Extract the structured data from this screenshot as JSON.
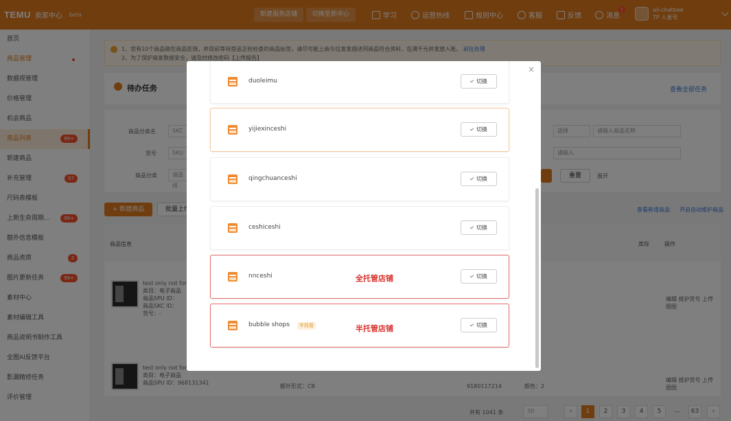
{
  "topbar": {
    "logo": "TEMU",
    "subtitle": "卖家中心",
    "beta": "beta",
    "buttons": [
      "新建服务店铺",
      "切换至新中心"
    ],
    "nav": [
      {
        "label": "学习",
        "icon": "book-icon"
      },
      {
        "label": "运营热线",
        "icon": "chat-icon"
      },
      {
        "label": "规则中心",
        "icon": "rules-icon"
      },
      {
        "label": "客服",
        "icon": "headset-icon"
      },
      {
        "label": "反馈",
        "icon": "feedback-icon"
      },
      {
        "label": "消息",
        "icon": "bell-icon"
      }
    ],
    "user_line1": "ali-chatbee",
    "user_line2": "TP 人发号"
  },
  "sidebar": {
    "items": [
      {
        "label": "首页"
      },
      {
        "label": "商品管理",
        "dot": true
      },
      {
        "label": "数据视管理"
      },
      {
        "label": "价格管理"
      },
      {
        "label": "机会商品"
      },
      {
        "label": "商品列表",
        "badge": "99+"
      },
      {
        "label": "新建商品"
      },
      {
        "label": "补充管理",
        "badge": "57"
      },
      {
        "label": "尺码表模板"
      },
      {
        "label": "上新生命周期...",
        "badge": "99+"
      },
      {
        "label": "额外信息模板"
      },
      {
        "label": "商品资质",
        "badge": "3"
      },
      {
        "label": "图片更新任务",
        "badge": "99+"
      },
      {
        "label": "素材中心"
      },
      {
        "label": "素材编辑工具"
      },
      {
        "label": "商品说明书制作工具"
      },
      {
        "label": "全图AI反馈平台"
      },
      {
        "label": "影漏精修任务"
      },
      {
        "label": "评价管理"
      }
    ]
  },
  "main": {
    "notice_line1": "1、您有10个商品做在商品反馈，并目前等待首运正检检查的商品标签，请尽可能上商与位发发描述同商品符合资料，在满千元并发放入账。",
    "notice_link": "前往处理",
    "notice_line2": "2、为了保护商家数据安全，请及时修改密码【上传报告】",
    "todo_title": "待办任务",
    "todo_link": "查看全部任务",
    "form": {
      "label1": "商品分类名",
      "value1": "SKC",
      "label2": "货号",
      "value2": "SKU",
      "label3": "商品分类",
      "value3": "请选择",
      "label4": "选择",
      "placeholder4": "请输入商品名称",
      "placeholder5": "请输入",
      "reset": "重置",
      "expand": "展开"
    },
    "btn_new": "+ 新建商品",
    "btn_batch": "批量上传",
    "right_links": [
      "查看新增商品",
      "开启自动维护商品"
    ],
    "table_headers": [
      "商品信息",
      "销量",
      "库存",
      "操作"
    ],
    "row1": {
      "title": "test only not for sale",
      "meta1": "类目：电子商品",
      "meta2": "商品SPU ID：",
      "meta3": "商品SKC ID：",
      "meta4": "货号：-",
      "actions": "编辑  维护货号  上传图图"
    },
    "row2": {
      "title": "test only not for sale",
      "meta1": "类目：电子商品",
      "meta2": "商品SPU ID：968131341",
      "spec": "额外形式：CB",
      "sku": "9180117214",
      "color": "颜色：2",
      "actions": "编辑  维护货号  上传图图"
    },
    "pagination": {
      "total": "共有 1041 条",
      "per_page": "30",
      "pages": [
        "1",
        "2",
        "3",
        "4",
        "5",
        "...",
        "63"
      ]
    }
  },
  "modal": {
    "shops": [
      {
        "name": "duoleimu",
        "switch": "切换",
        "tag": "",
        "note": ""
      },
      {
        "name": "yijiexinceshi",
        "switch": "切换",
        "tag": "",
        "note": ""
      },
      {
        "name": "qingchuanceshi",
        "switch": "切换",
        "tag": "",
        "note": ""
      },
      {
        "name": "ceshiceshi",
        "switch": "切换",
        "tag": "",
        "note": ""
      },
      {
        "name": "nnceshi",
        "switch": "切换",
        "tag": "",
        "note": "全托管店铺"
      },
      {
        "name": "bubble shops",
        "switch": "切换",
        "tag": "半托管",
        "note": "半托管店铺"
      }
    ]
  },
  "colors": {
    "brand": "#e07a1f",
    "highlight": "#e36a6a",
    "note": "#d8322c"
  }
}
